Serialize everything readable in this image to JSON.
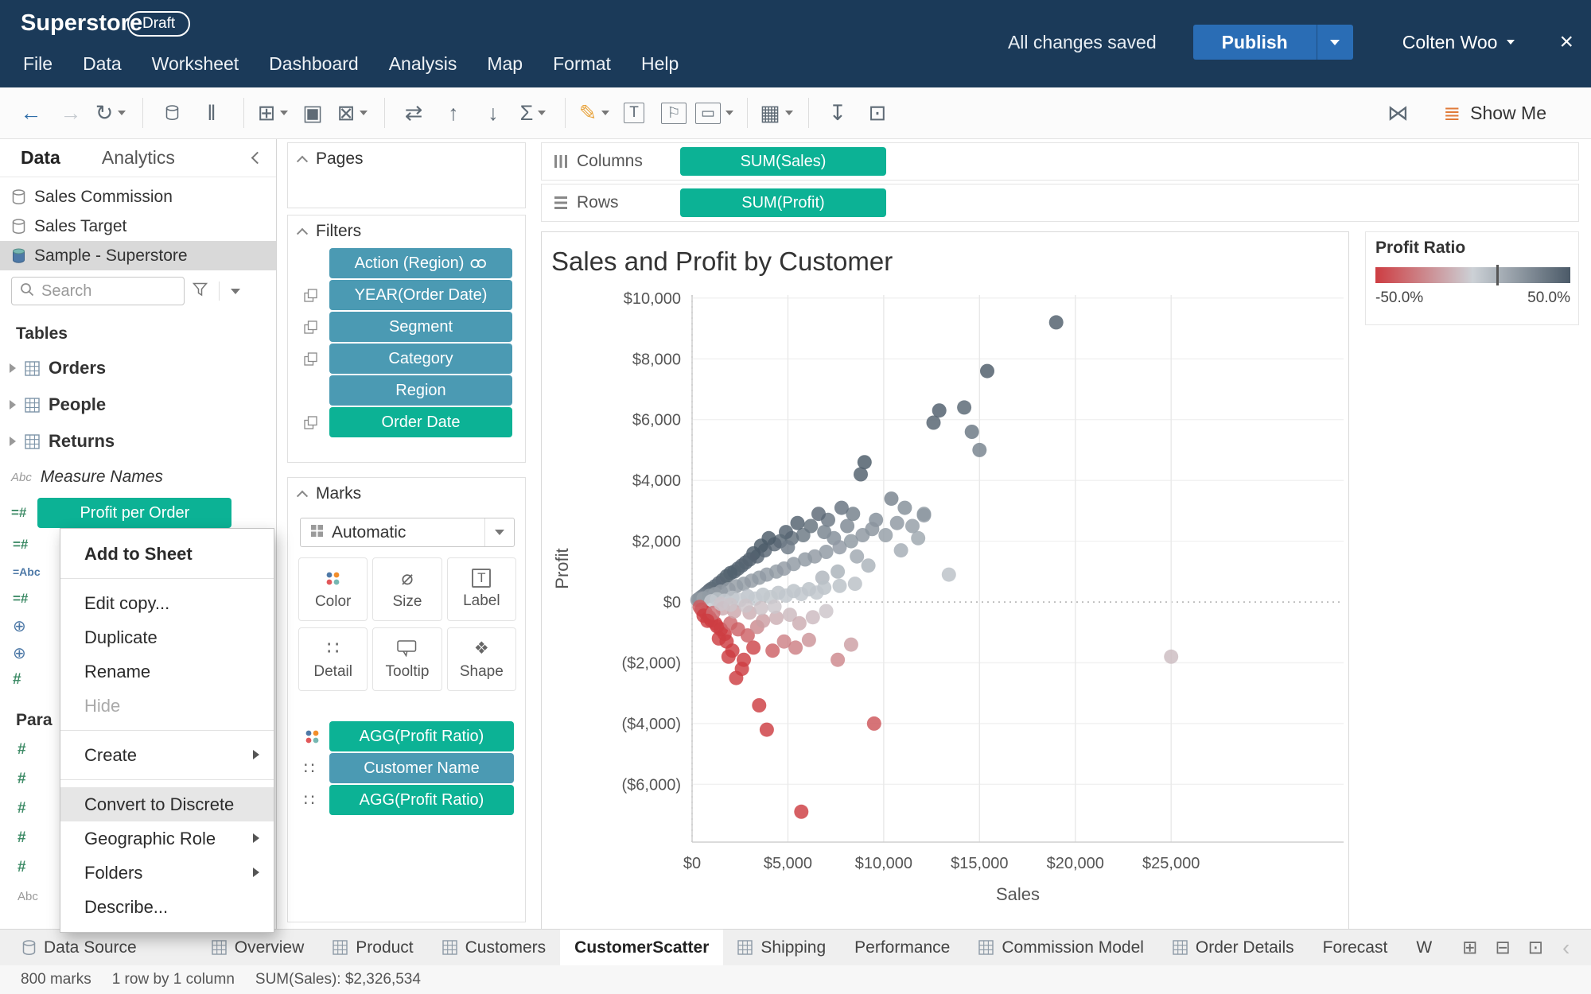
{
  "titlebar": {
    "app_title": "Superstore",
    "badge": "Draft",
    "menus": [
      "File",
      "Data",
      "Worksheet",
      "Dashboard",
      "Analysis",
      "Map",
      "Format",
      "Help"
    ],
    "saved_status": "All changes saved",
    "publish_label": "Publish",
    "user_name": "Colten Woo",
    "close_glyph": "×"
  },
  "toolbar": {
    "show_me_label": "Show Me",
    "icons": [
      {
        "name": "back-icon",
        "glyph": "←",
        "color": "#2e6da8"
      },
      {
        "name": "forward-icon",
        "glyph": "→",
        "color": "#c6cbd0"
      },
      {
        "name": "redo-icon",
        "glyph": "↻",
        "color": "#5f6b76",
        "dropdown": true
      },
      {
        "name": "sep",
        "sep": true
      },
      {
        "name": "new-data-source-icon",
        "svg": "cylinder",
        "color": "#5f6b76"
      },
      {
        "name": "pause-auto-updates-icon",
        "glyph": "‖",
        "color": "#5f6b76"
      },
      {
        "name": "sep",
        "sep": true
      },
      {
        "name": "new-worksheet-icon",
        "glyph": "⊞",
        "color": "#5f6b76",
        "dropdown": true
      },
      {
        "name": "duplicate-icon",
        "glyph": "▣",
        "color": "#5f6b76"
      },
      {
        "name": "clear-sheet-icon",
        "glyph": "⊠",
        "color": "#5f6b76",
        "dropdown": true
      },
      {
        "name": "sep",
        "sep": true
      },
      {
        "name": "swap-rows-columns-icon",
        "glyph": "⇄",
        "color": "#5f6b76"
      },
      {
        "name": "sort-ascending-icon",
        "glyph": "↑",
        "color": "#5f6b76"
      },
      {
        "name": "sort-descending-icon",
        "glyph": "↓",
        "color": "#5f6b76"
      },
      {
        "name": "totals-icon",
        "glyph": "Σ",
        "color": "#5f6b76",
        "dropdown": true
      },
      {
        "name": "sep",
        "sep": true
      },
      {
        "name": "highlight-icon",
        "glyph": "✎",
        "color": "#e8a33c",
        "dropdown": true
      },
      {
        "name": "text-label-icon",
        "glyph": "T",
        "color": "#5f6b76",
        "boxed": true
      },
      {
        "name": "show-mark-labels-icon",
        "glyph": "⚐",
        "color": "#5f6b76",
        "boxed": true
      },
      {
        "name": "fit-icon",
        "glyph": "▭",
        "color": "#5f6b76",
        "boxed": true,
        "dropdown": true
      },
      {
        "name": "sep",
        "sep": true
      },
      {
        "name": "cell-size-icon",
        "glyph": "▦",
        "color": "#5f6b76",
        "dropdown": true
      },
      {
        "name": "sep",
        "sep": true
      },
      {
        "name": "download-icon",
        "glyph": "↧",
        "color": "#5f6b76"
      },
      {
        "name": "presentation-icon",
        "glyph": "⊡",
        "color": "#5f6b76"
      }
    ],
    "right_icons": [
      {
        "name": "mirror-icon",
        "glyph": "⋈",
        "color": "#5f6b76"
      },
      {
        "name": "show-me-icon",
        "glyph": "≣",
        "color": "#e07b39"
      }
    ]
  },
  "data_panel": {
    "tabs": [
      {
        "label": "Data",
        "active": true
      },
      {
        "label": "Analytics",
        "active": false
      }
    ],
    "sources": [
      {
        "label": "Sales Commission",
        "selected": false,
        "icon": "cylinder"
      },
      {
        "label": "Sales Target",
        "selected": false,
        "icon": "cylinder"
      },
      {
        "label": "Sample - Superstore",
        "selected": true,
        "icon": "cylinder-color"
      }
    ],
    "search": {
      "placeholder": "Search"
    },
    "tables_header": "Tables",
    "tables": [
      {
        "label": "Orders"
      },
      {
        "label": "People"
      },
      {
        "label": "Returns"
      }
    ],
    "measure_names_label": "Measure Names",
    "selected_field": {
      "label": "Profit per Order",
      "color": "green"
    },
    "hidden_field_icons": [
      "calc-measure",
      "calc-abc",
      "calc-measure",
      "globe",
      "globe",
      "hash"
    ],
    "parameters_header": "Para",
    "parameter_icons": [
      "hash",
      "hash",
      "hash",
      "hash",
      "hash"
    ],
    "trailing_icon": "abc"
  },
  "context_menu": {
    "items": [
      {
        "label": "Add to Sheet",
        "bold": true
      },
      {
        "divider": true
      },
      {
        "label": "Edit copy..."
      },
      {
        "label": "Duplicate"
      },
      {
        "label": "Rename"
      },
      {
        "label": "Hide",
        "disabled": true
      },
      {
        "divider": true
      },
      {
        "label": "Create",
        "submenu": true
      },
      {
        "divider": true
      },
      {
        "label": "Convert to Discrete",
        "highlighted": true
      },
      {
        "label": "Geographic Role",
        "submenu": true
      },
      {
        "label": "Folders",
        "submenu": true
      },
      {
        "label": "Describe..."
      }
    ]
  },
  "pill_colors": {
    "green": "#0cb295",
    "teal": "#4b9ab3"
  },
  "cards": {
    "pages": {
      "title": "Pages"
    },
    "filters": {
      "title": "Filters",
      "pills": [
        {
          "label": "Action (Region)",
          "color": "teal",
          "right_icon": "link"
        },
        {
          "label": "YEAR(Order Date)",
          "color": "teal",
          "margin_icon": true
        },
        {
          "label": "Segment",
          "color": "teal",
          "margin_icon": true
        },
        {
          "label": "Category",
          "color": "teal",
          "margin_icon": true
        },
        {
          "label": "Region",
          "color": "teal"
        },
        {
          "label": "Order Date",
          "color": "green",
          "margin_icon": true
        }
      ]
    },
    "marks": {
      "title": "Marks",
      "mark_type": "Automatic",
      "buttons": [
        {
          "label": "Color",
          "icon": "color-dots"
        },
        {
          "label": "Size",
          "icon": "size"
        },
        {
          "label": "Label",
          "icon": "label-T"
        },
        {
          "label": "Detail",
          "icon": "detail"
        },
        {
          "label": "Tooltip",
          "icon": "tooltip"
        },
        {
          "label": "Shape",
          "icon": "shape"
        }
      ],
      "pills": [
        {
          "label": "AGG(Profit Ratio)",
          "color": "green",
          "icon": "color-dots"
        },
        {
          "label": "Customer Name",
          "color": "teal",
          "icon": "detail"
        },
        {
          "label": "AGG(Profit Ratio)",
          "color": "green",
          "icon": "detail"
        }
      ]
    }
  },
  "shelves": {
    "columns_label": "Columns",
    "rows_label": "Rows",
    "columns_pills": [
      {
        "label": "SUM(Sales)",
        "color": "green"
      }
    ],
    "rows_pills": [
      {
        "label": "SUM(Profit)",
        "color": "green"
      }
    ]
  },
  "legend": {
    "title": "Profit Ratio",
    "min_label": "-50.0%",
    "max_label": "50.0%",
    "colors": [
      "#cd3d42",
      "#ccd1d6",
      "#4b5a68"
    ],
    "marker_position": 0.62
  },
  "chart_data": {
    "type": "scatter",
    "title": "Sales and Profit by Customer",
    "xlabel": "Sales",
    "ylabel": "Profit",
    "xlim": [
      0,
      34000
    ],
    "ylim": [
      -7900,
      10100
    ],
    "x_ticks": [
      0,
      5000,
      10000,
      15000,
      20000,
      25000
    ],
    "x_tick_labels": [
      "$0",
      "$5,000",
      "$10,000",
      "$15,000",
      "$20,000",
      "$25,000"
    ],
    "y_ticks": [
      -6000,
      -4000,
      -2000,
      0,
      2000,
      4000,
      6000,
      8000,
      10000
    ],
    "y_tick_labels": [
      "($6,000)",
      "($4,000)",
      "($2,000)",
      "$0",
      "$2,000",
      "$4,000",
      "$6,000",
      "$8,000",
      "$10,000"
    ],
    "color_field": "AGG(Profit Ratio)",
    "color_domain": [
      -0.5,
      0.5
    ],
    "color_range": [
      "#cd3d42",
      "#ccd1d6",
      "#4b5a68"
    ],
    "grid": true,
    "points": [
      [
        19000,
        9200
      ],
      [
        15400,
        7600
      ],
      [
        14200,
        6400
      ],
      [
        12900,
        6300
      ],
      [
        12600,
        5900
      ],
      [
        14600,
        5600
      ],
      [
        15000,
        5000
      ],
      [
        9000,
        4600
      ],
      [
        8800,
        4200
      ],
      [
        10400,
        3400
      ],
      [
        11100,
        3100
      ],
      [
        12100,
        2900
      ],
      [
        9600,
        2700
      ],
      [
        8400,
        2900
      ],
      [
        7800,
        3100
      ],
      [
        8100,
        2500
      ],
      [
        7100,
        2700
      ],
      [
        6600,
        2900
      ],
      [
        6900,
        2300
      ],
      [
        7400,
        2100
      ],
      [
        6200,
        2500
      ],
      [
        5800,
        2200
      ],
      [
        5500,
        2600
      ],
      [
        5200,
        2100
      ],
      [
        4900,
        2300
      ],
      [
        4600,
        2000
      ],
      [
        5000,
        1800
      ],
      [
        4300,
        1900
      ],
      [
        4000,
        2100
      ],
      [
        3800,
        1700
      ],
      [
        3600,
        1850
      ],
      [
        3400,
        1500
      ],
      [
        3200,
        1600
      ],
      [
        3000,
        1400
      ],
      [
        2800,
        1300
      ],
      [
        2600,
        1200
      ],
      [
        2400,
        1100
      ],
      [
        2200,
        1000
      ],
      [
        2000,
        950
      ],
      [
        1800,
        850
      ],
      [
        1600,
        720
      ],
      [
        1400,
        620
      ],
      [
        1200,
        520
      ],
      [
        1000,
        430
      ],
      [
        900,
        380
      ],
      [
        800,
        320
      ],
      [
        700,
        270
      ],
      [
        600,
        210
      ],
      [
        500,
        170
      ],
      [
        420,
        130
      ],
      [
        350,
        95
      ],
      [
        280,
        70
      ],
      [
        600,
        120
      ],
      [
        900,
        200
      ],
      [
        1200,
        260
      ],
      [
        1500,
        340
      ],
      [
        1900,
        420
      ],
      [
        2300,
        520
      ],
      [
        2700,
        600
      ],
      [
        3100,
        700
      ],
      [
        3500,
        800
      ],
      [
        3900,
        900
      ],
      [
        4400,
        1000
      ],
      [
        4800,
        1100
      ],
      [
        5300,
        1250
      ],
      [
        5900,
        1400
      ],
      [
        6400,
        1500
      ],
      [
        7000,
        1650
      ],
      [
        7700,
        1800
      ],
      [
        8300,
        2000
      ],
      [
        8900,
        2200
      ],
      [
        9400,
        2400
      ],
      [
        10100,
        2200
      ],
      [
        10700,
        2600
      ],
      [
        11500,
        2500
      ],
      [
        12100,
        2850
      ],
      [
        8600,
        1500
      ],
      [
        9200,
        1200
      ],
      [
        7600,
        1000
      ],
      [
        6800,
        800
      ],
      [
        13400,
        900
      ],
      [
        10900,
        1700
      ],
      [
        11800,
        2100
      ],
      [
        1300,
        90
      ],
      [
        2100,
        140
      ],
      [
        2900,
        190
      ],
      [
        3700,
        240
      ],
      [
        4500,
        300
      ],
      [
        5300,
        360
      ],
      [
        6100,
        420
      ],
      [
        6900,
        470
      ],
      [
        7700,
        530
      ],
      [
        8500,
        600
      ],
      [
        2500,
        60
      ],
      [
        3300,
        110
      ],
      [
        4100,
        160
      ],
      [
        4900,
        210
      ],
      [
        5700,
        260
      ],
      [
        6500,
        310
      ],
      [
        1700,
        40
      ],
      [
        1000,
        25
      ],
      [
        25000,
        -1800
      ],
      [
        9500,
        -4000
      ],
      [
        5700,
        -6900
      ],
      [
        2300,
        -2500
      ],
      [
        3500,
        -3400
      ],
      [
        3900,
        -4200
      ],
      [
        1800,
        -1300
      ],
      [
        2100,
        -1600
      ],
      [
        2700,
        -1900
      ],
      [
        3200,
        -1500
      ],
      [
        4200,
        -1600
      ],
      [
        4800,
        -1300
      ],
      [
        5400,
        -1500
      ],
      [
        6100,
        -1250
      ],
      [
        7600,
        -1900
      ],
      [
        8300,
        -1400
      ],
      [
        1200,
        -700
      ],
      [
        1500,
        -900
      ],
      [
        900,
        -500
      ],
      [
        700,
        -350
      ],
      [
        500,
        -250
      ],
      [
        400,
        -160
      ],
      [
        600,
        -450
      ],
      [
        1000,
        -600
      ],
      [
        1300,
        -800
      ],
      [
        1700,
        -1050
      ],
      [
        2000,
        -700
      ],
      [
        2400,
        -900
      ],
      [
        2900,
        -1100
      ],
      [
        3400,
        -820
      ],
      [
        3700,
        -620
      ],
      [
        4400,
        -520
      ],
      [
        5100,
        -420
      ],
      [
        2200,
        -310
      ],
      [
        1600,
        -210
      ],
      [
        1100,
        -360
      ],
      [
        800,
        -620
      ],
      [
        1400,
        -1200
      ],
      [
        1900,
        -1800
      ],
      [
        2600,
        -2200
      ],
      [
        3000,
        -350
      ],
      [
        3600,
        -200
      ],
      [
        4300,
        -150
      ],
      [
        2800,
        -120
      ],
      [
        2000,
        -90
      ],
      [
        1500,
        -60
      ],
      [
        5600,
        -700
      ],
      [
        6300,
        -500
      ],
      [
        7000,
        -300
      ]
    ]
  },
  "sheet_tabs": {
    "tabs": [
      {
        "label": "Data Source",
        "icon": "cylinder"
      },
      {
        "label": "Overview",
        "icon": "grid"
      },
      {
        "label": "Product",
        "icon": "grid"
      },
      {
        "label": "Customers",
        "icon": "grid"
      },
      {
        "label": "CustomerScatter",
        "icon": "none",
        "active": true
      },
      {
        "label": "Shipping",
        "icon": "grid"
      },
      {
        "label": "Performance",
        "icon": "none"
      },
      {
        "label": "Commission Model",
        "icon": "grid"
      },
      {
        "label": "Order Details",
        "icon": "grid"
      },
      {
        "label": "Forecast",
        "icon": "none"
      },
      {
        "label": "W",
        "icon": "none"
      }
    ],
    "actions": [
      {
        "name": "new-worksheet-tab-icon",
        "glyph": "⊞"
      },
      {
        "name": "new-dashboard-icon",
        "glyph": "⊟"
      },
      {
        "name": "new-story-icon",
        "glyph": "⊡"
      }
    ],
    "nav": [
      {
        "name": "scroll-left-icon",
        "glyph": "‹"
      },
      {
        "name": "scroll-right-icon",
        "glyph": "›"
      }
    ]
  },
  "status_bar": {
    "marks_count": "800 marks",
    "layout_info": "1 row by 1 column",
    "aggregate_info": "SUM(Sales): $2,326,534"
  }
}
